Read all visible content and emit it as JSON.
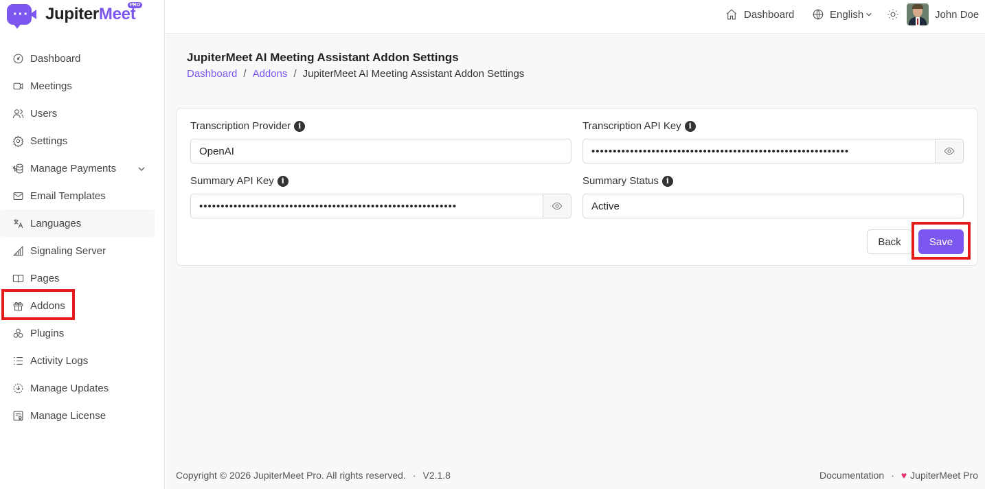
{
  "app": {
    "logo_text_a": "Jupiter",
    "logo_text_b": "Meet",
    "logo_badge": "PRO"
  },
  "sidebar": {
    "items": [
      {
        "label": "Dashboard",
        "icon": "dashboard-icon"
      },
      {
        "label": "Meetings",
        "icon": "video-icon"
      },
      {
        "label": "Users",
        "icon": "users-icon"
      },
      {
        "label": "Settings",
        "icon": "gear-icon"
      },
      {
        "label": "Manage Payments",
        "icon": "payments-icon"
      },
      {
        "label": "Email Templates",
        "icon": "mail-icon"
      },
      {
        "label": "Languages",
        "icon": "translate-icon"
      },
      {
        "label": "Signaling Server",
        "icon": "signal-icon"
      },
      {
        "label": "Pages",
        "icon": "book-icon"
      },
      {
        "label": "Addons",
        "icon": "gift-icon"
      },
      {
        "label": "Plugins",
        "icon": "plugins-icon"
      },
      {
        "label": "Activity Logs",
        "icon": "list-icon"
      },
      {
        "label": "Manage Updates",
        "icon": "update-icon"
      },
      {
        "label": "Manage License",
        "icon": "license-icon"
      }
    ]
  },
  "header": {
    "dashboard_label": "Dashboard",
    "language_label": "English",
    "user_name": "John Doe"
  },
  "page": {
    "title": "JupiterMeet AI Meeting Assistant Addon Settings",
    "breadcrumb": {
      "home": "Dashboard",
      "section": "Addons",
      "current": "JupiterMeet AI Meeting Assistant Addon Settings",
      "separator": "/"
    }
  },
  "form": {
    "transcription_provider": {
      "label": "Transcription Provider",
      "value": "OpenAI"
    },
    "transcription_api_key": {
      "label": "Transcription API Key",
      "value": "••••••••••••••••••••••••••••••••••••••••••••••••••••••••••••"
    },
    "summary_api_key": {
      "label": "Summary API Key",
      "value": "••••••••••••••••••••••••••••••••••••••••••••••••••••••••••••"
    },
    "summary_status": {
      "label": "Summary Status",
      "value": "Active"
    },
    "info_glyph": "i",
    "back_label": "Back",
    "save_label": "Save"
  },
  "footer": {
    "copyright": "Copyright © 2026 JupiterMeet Pro. All rights reserved.",
    "version": "V2.1.8",
    "separator": "·",
    "documentation": "Documentation",
    "brand": "JupiterMeet Pro"
  },
  "colors": {
    "accent": "#7b57f0",
    "highlight": "#e31b1b",
    "heart": "#e3306c"
  }
}
